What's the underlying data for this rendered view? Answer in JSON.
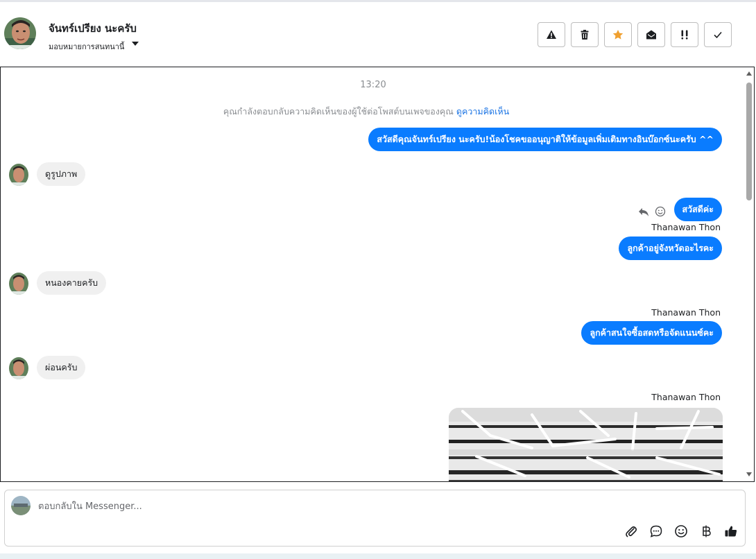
{
  "header": {
    "contact_name": "จันทร์เปรียง นะครับ",
    "assign_label": "มอบหมายการสนทนานี้",
    "actions": [
      {
        "name": "warning-icon",
        "icon": "warning"
      },
      {
        "name": "trash-icon",
        "icon": "trash"
      },
      {
        "name": "star-icon",
        "icon": "star",
        "color": "#f0a030"
      },
      {
        "name": "envelope-open-icon",
        "icon": "envelope-open"
      },
      {
        "name": "double-exclamation-icon",
        "icon": "double-exclamation"
      },
      {
        "name": "check-icon",
        "icon": "check"
      }
    ]
  },
  "chat": {
    "time": "13:20",
    "notice_text": "คุณกำลังตอบกลับความคิดเห็นของผู้ใช้ต่อโพสต์บนเพจของคุณ",
    "notice_link": "ดูความคิดเห็น",
    "messages": [
      {
        "direction": "out",
        "text": "สวัสดีคุณจันทร์เปรียง นะครับ!น้องโชคขออนุญาติให้ข้อมูลเพิ่มเติมทางอินบ๊อกซ์นะครับ ^^"
      },
      {
        "direction": "in",
        "text": "ดูรูปภาพ"
      },
      {
        "direction": "out",
        "text": "สวัสดีค่ะ"
      },
      {
        "direction": "out",
        "sender": "Thanawan Thon",
        "text": "ลูกค้าอยู่จังหวัดอะไรคะ"
      },
      {
        "direction": "in",
        "text": "หนองคายครับ"
      },
      {
        "direction": "out",
        "sender": "Thanawan Thon",
        "text": "ลูกค้าสนใจซื้อสดหรือจัดแนนซ์คะ"
      },
      {
        "direction": "in",
        "text": "ผ่อนครับ"
      },
      {
        "direction": "out",
        "sender": "Thanawan Thon",
        "type": "image"
      }
    ]
  },
  "composer": {
    "placeholder": "ตอบกลับใน Messenger..."
  },
  "colors": {
    "outgoing_bubble": "#0a7cff",
    "incoming_bubble": "#f0f0f0",
    "link": "#1b74e4"
  }
}
